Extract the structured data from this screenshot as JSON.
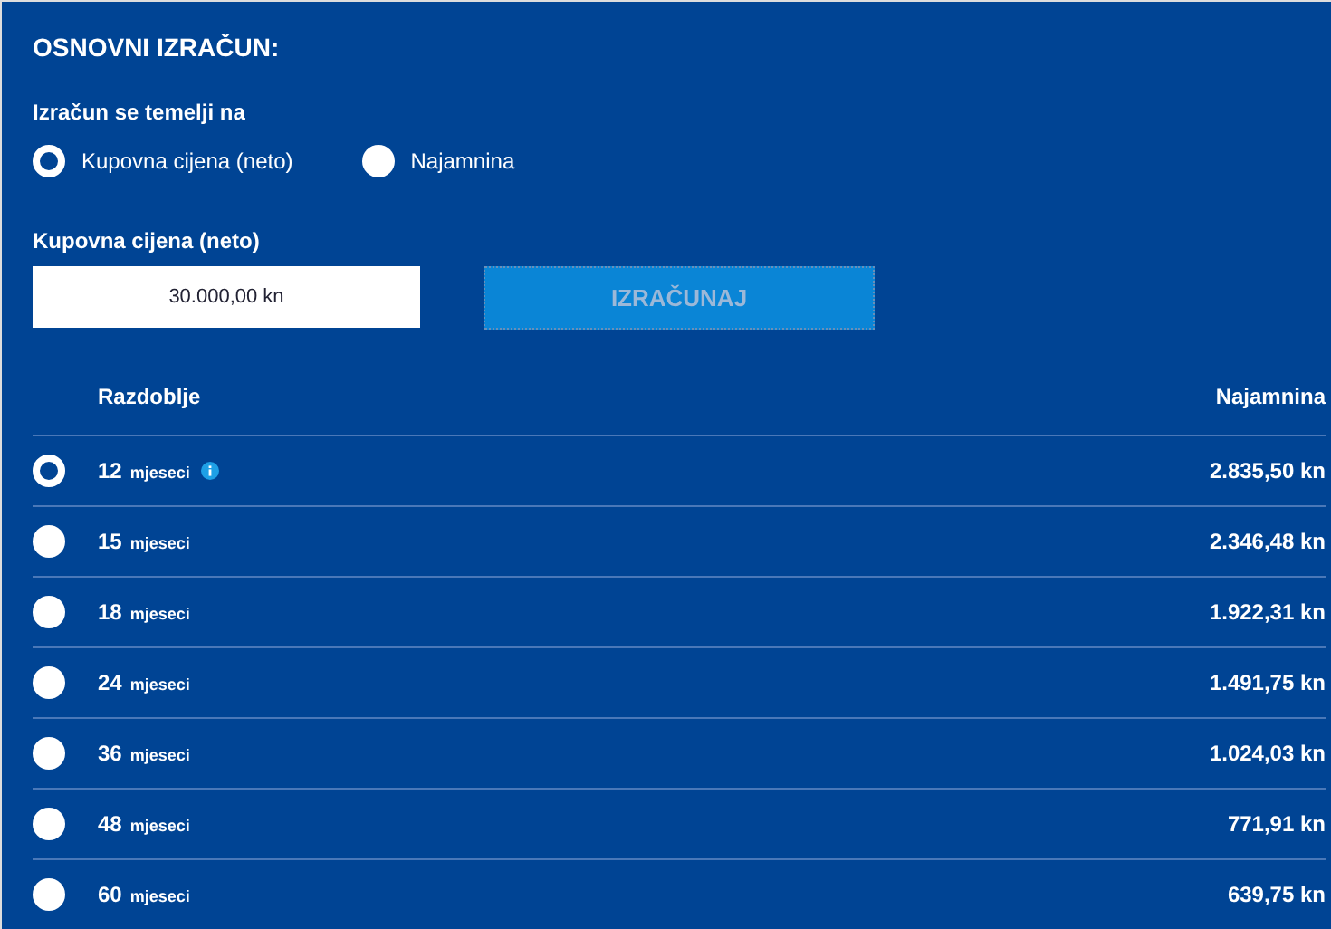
{
  "title": "OSNOVNI IZRAČUN:",
  "basis": {
    "label": "Izračun se temelji na",
    "options": [
      {
        "label": "Kupovna cijena (neto)",
        "selected": true
      },
      {
        "label": "Najamnina",
        "selected": false
      }
    ]
  },
  "price": {
    "label": "Kupovna cijena (neto)",
    "value": "30.000,00 kn"
  },
  "calculate_button": {
    "label": "IZRAČUNAJ",
    "disabled": true
  },
  "table": {
    "columns": [
      "Razdoblje",
      "Najamnina"
    ],
    "rows": [
      {
        "number": "12",
        "unit": "mjeseci",
        "info": true,
        "amount": "2.835,50 kn",
        "selected": true
      },
      {
        "number": "15",
        "unit": "mjeseci",
        "info": false,
        "amount": "2.346,48 kn",
        "selected": false
      },
      {
        "number": "18",
        "unit": "mjeseci",
        "info": false,
        "amount": "1.922,31 kn",
        "selected": false
      },
      {
        "number": "24",
        "unit": "mjeseci",
        "info": false,
        "amount": "1.491,75 kn",
        "selected": false
      },
      {
        "number": "36",
        "unit": "mjeseci",
        "info": false,
        "amount": "1.024,03 kn",
        "selected": false
      },
      {
        "number": "48",
        "unit": "mjeseci",
        "info": false,
        "amount": "771,91 kn",
        "selected": false
      },
      {
        "number": "60",
        "unit": "mjeseci",
        "info": false,
        "amount": "639,75 kn",
        "selected": false
      }
    ]
  }
}
